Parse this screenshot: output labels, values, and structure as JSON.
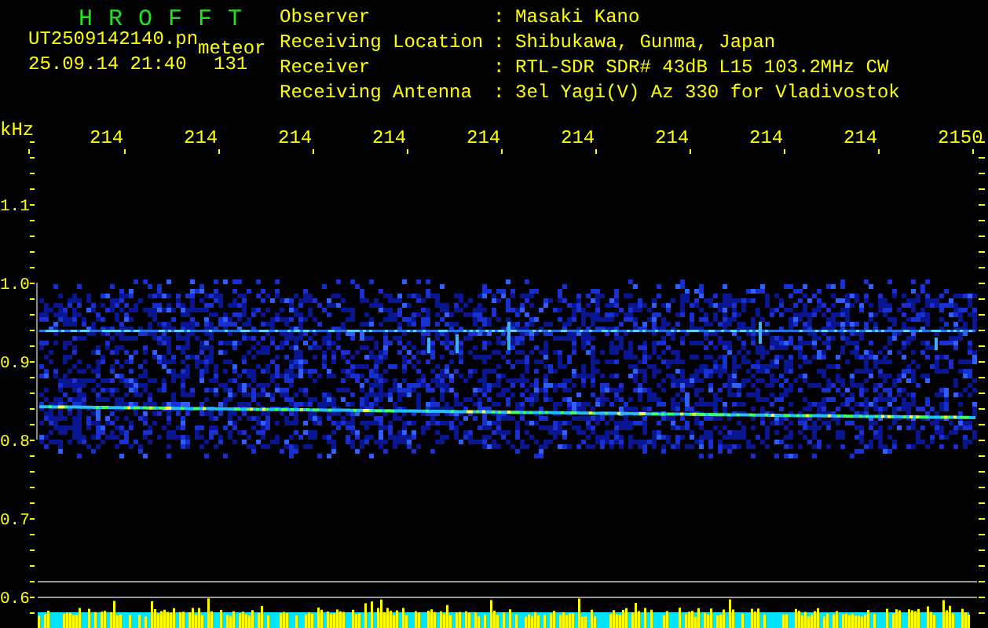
{
  "title": "HROFFT",
  "file_name": "UT2509142140.pn",
  "mode": "meteor",
  "timestamp": "25.09.14 21:40",
  "count": "131",
  "info": [
    {
      "label": "Observer",
      "separator": ":",
      "value": "Masaki Kano"
    },
    {
      "label": "Receiving Location",
      "separator": ":",
      "value": "Shibukawa, Gunma, Japan"
    },
    {
      "label": "Receiver",
      "separator": ":",
      "value": "RTL-SDR SDR# 43dB L15 103.2MHz CW"
    },
    {
      "label": "Receiving Antenna",
      "separator": ":",
      "value": "3el Yagi(V) Az 330 for Vladivostok"
    }
  ],
  "plot": {
    "unit": "kHz",
    "x_labels": [
      "214",
      "214",
      "214",
      "214",
      "214",
      "214",
      "214",
      "214",
      "214",
      "2150"
    ],
    "y_labels": [
      "1.1",
      "1.0",
      "0.9",
      "0.8",
      "0.7",
      "0.6"
    ]
  }
}
